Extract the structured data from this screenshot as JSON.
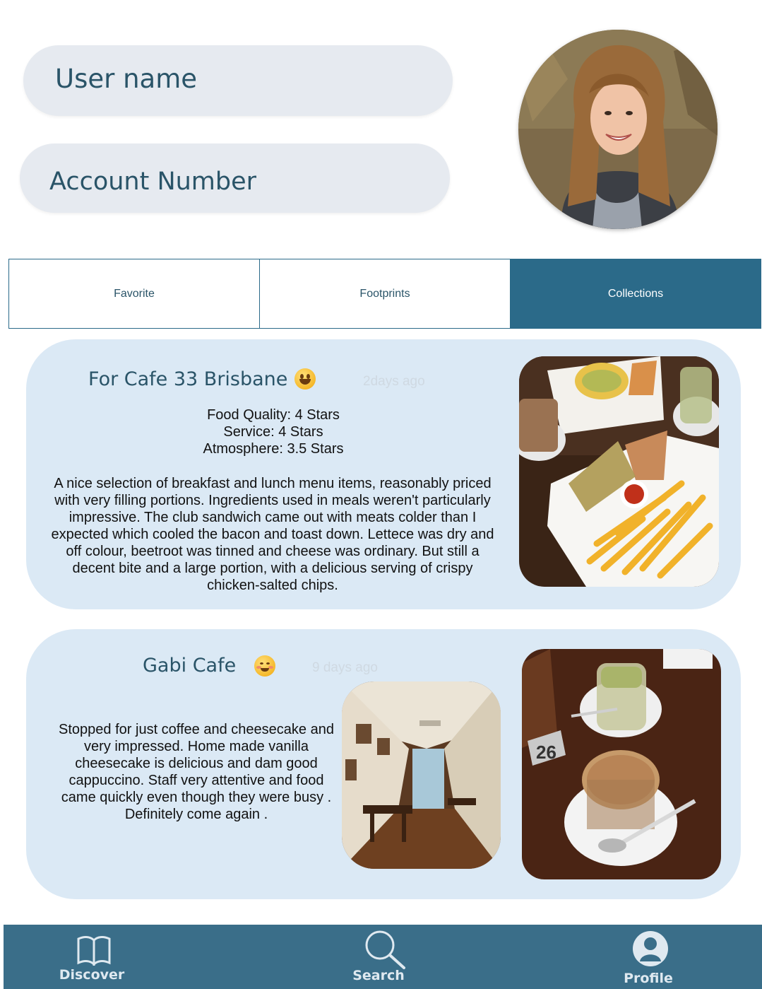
{
  "header": {
    "username_label": "User name",
    "account_label": "Account Number"
  },
  "tabs": [
    {
      "label": "Favorite",
      "active": false
    },
    {
      "label": "Footprints",
      "active": false
    },
    {
      "label": "Collections",
      "active": true
    }
  ],
  "posts": [
    {
      "title": "For Cafe 33 Brisbane",
      "emoji": "grinning-face-icon",
      "time_ago": "2days ago",
      "ratings": [
        "Food Quality: 4 Stars",
        "Service: 4 Stars",
        "Atmosphere: 3.5 Stars"
      ],
      "review": "A nice selection of breakfast and lunch menu items, reasonably priced with very filling portions. Ingredients used in meals weren't particularly impressive. The club sandwich came out with meats colder than I expected which cooled the bacon and toast down. Lettece was dry and off colour, beetroot was tinned and cheese was ordinary. But still a decent bite and a large portion, with a delicious serving of crispy chicken-salted chips."
    },
    {
      "title": "Gabi Cafe",
      "emoji": "smiling-blush-face-icon",
      "time_ago": "9 days  ago",
      "review": "Stopped for just coffee and cheesecake and very impressed. Home made vanilla cheesecake is delicious and dam good cappuccino. Staff very attentive and food came quickly even though they were busy . Definitely come again ."
    }
  ],
  "bottom_nav": [
    {
      "label": "Discover",
      "icon": "book-icon"
    },
    {
      "label": "Search",
      "icon": "magnifier-icon"
    },
    {
      "label": "Profile",
      "icon": "person-icon"
    }
  ],
  "colors": {
    "accent": "#2b6a89",
    "nav_bar": "#3a6e89",
    "card_bg": "#dbe9f5",
    "pill_bg": "#e6eaf0",
    "title_text": "#2a5468"
  }
}
